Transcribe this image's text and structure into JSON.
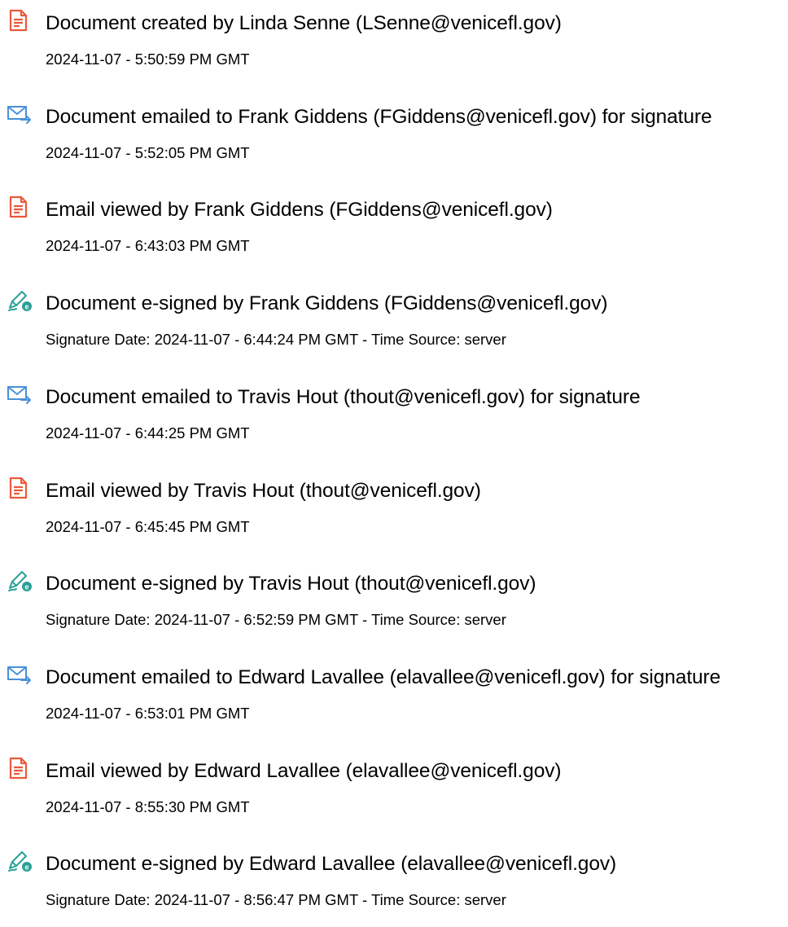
{
  "colors": {
    "document_icon": "#e8593c",
    "email_icon": "#4a90d9",
    "signed_icon": "#2aa198"
  },
  "events": [
    {
      "icon": "document-icon",
      "title": "Document created by Linda Senne (LSenne@venicefl.gov)",
      "time": "2024-11-07 - 5:50:59 PM GMT"
    },
    {
      "icon": "email-send-icon",
      "title": "Document emailed to Frank Giddens (FGiddens@venicefl.gov) for signature",
      "time": "2024-11-07 - 5:52:05 PM GMT"
    },
    {
      "icon": "document-icon",
      "title": "Email viewed by Frank Giddens (FGiddens@venicefl.gov)",
      "time": "2024-11-07 - 6:43:03 PM GMT"
    },
    {
      "icon": "esign-pen-icon",
      "title": "Document e-signed by Frank Giddens (FGiddens@venicefl.gov)",
      "time": "Signature Date: 2024-11-07 - 6:44:24 PM GMT - Time Source: server"
    },
    {
      "icon": "email-send-icon",
      "title": "Document emailed to Travis Hout (thout@venicefl.gov) for signature",
      "time": "2024-11-07 - 6:44:25 PM GMT"
    },
    {
      "icon": "document-icon",
      "title": "Email viewed by Travis Hout (thout@venicefl.gov)",
      "time": "2024-11-07 - 6:45:45 PM GMT"
    },
    {
      "icon": "esign-pen-icon",
      "title": "Document e-signed by Travis Hout (thout@venicefl.gov)",
      "time": "Signature Date: 2024-11-07 - 6:52:59 PM GMT - Time Source: server"
    },
    {
      "icon": "email-send-icon",
      "title": "Document emailed to Edward Lavallee (elavallee@venicefl.gov) for signature",
      "time": "2024-11-07 - 6:53:01 PM GMT"
    },
    {
      "icon": "document-icon",
      "title": "Email viewed by Edward Lavallee (elavallee@venicefl.gov)",
      "time": "2024-11-07 - 8:55:30 PM GMT"
    },
    {
      "icon": "esign-pen-icon",
      "title": "Document e-signed by Edward Lavallee (elavallee@venicefl.gov)",
      "time": "Signature Date: 2024-11-07 - 8:56:47 PM GMT - Time Source: server"
    }
  ]
}
